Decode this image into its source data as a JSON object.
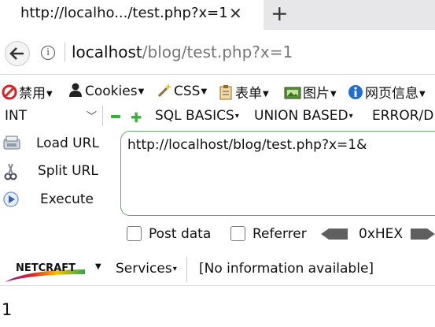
{
  "tab": {
    "title": "http://localho.../test.php?x=1",
    "close": "✕",
    "new": "+"
  },
  "navbar": {
    "url_host": "localhost",
    "url_path": "/blog/test.php?x=1",
    "info": "i"
  },
  "menubar": {
    "items": [
      "禁用",
      "Cookies",
      "CSS",
      "表单",
      "图片",
      "网页信息"
    ]
  },
  "hackbar": {
    "select_value": "INT",
    "menus": [
      "SQL BASICS",
      "UNION BASED",
      "ERROR/D"
    ],
    "load_url": "Load URL",
    "split_url": "Split URL",
    "execute": "Execute",
    "url_value": "http://localhost/blog/test.php?x=1&",
    "post_data": "Post data",
    "referrer": "Referrer",
    "hex": "0xHEX"
  },
  "netcraft": {
    "logo": "NETCRAFT",
    "services": "Services",
    "info": "[No information available]"
  },
  "page": {
    "output": "1"
  },
  "colors": {
    "accent_green": "#34b233",
    "url_box_border": "#6aa56a",
    "tab_strip": "#e7e7ea"
  }
}
